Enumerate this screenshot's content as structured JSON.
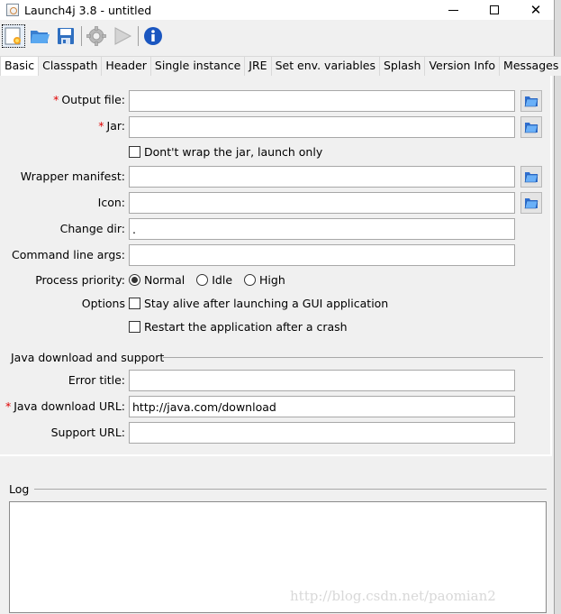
{
  "window": {
    "title": "Launch4j 3.8 - untitled",
    "controls": {
      "minimize": "minimize",
      "maximize": "maximize",
      "close": "✕"
    }
  },
  "toolbar": {
    "buttons": [
      {
        "name": "new-config",
        "icon": "new-file-icon",
        "selected": true
      },
      {
        "name": "open-config",
        "icon": "folder-open-icon"
      },
      {
        "name": "save-config",
        "icon": "save-icon"
      },
      {
        "name": "build-wrapper",
        "icon": "gear-icon",
        "disabled": true
      },
      {
        "name": "test-wrapper",
        "icon": "play-icon",
        "disabled": true
      },
      {
        "name": "about",
        "icon": "info-icon"
      }
    ]
  },
  "tabs": [
    {
      "label": "Basic",
      "active": true
    },
    {
      "label": "Classpath"
    },
    {
      "label": "Header"
    },
    {
      "label": "Single instance"
    },
    {
      "label": "JRE"
    },
    {
      "label": "Set env. variables"
    },
    {
      "label": "Splash"
    },
    {
      "label": "Version Info"
    },
    {
      "label": "Messages"
    }
  ],
  "basic": {
    "required_marker": "*",
    "output_file": {
      "label": "Output file:",
      "value": "",
      "required": true
    },
    "jar": {
      "label": "Jar:",
      "value": "",
      "required": true
    },
    "dont_wrap": {
      "label": "Dont't wrap the jar, launch only",
      "checked": false
    },
    "wrapper_manifest": {
      "label": "Wrapper manifest:",
      "value": ""
    },
    "icon": {
      "label": "Icon:",
      "value": ""
    },
    "change_dir": {
      "label": "Change dir:",
      "value": "."
    },
    "cmd_args": {
      "label": "Command line args:",
      "value": ""
    },
    "process_priority": {
      "label": "Process priority:",
      "options": [
        "Normal",
        "Idle",
        "High"
      ],
      "selected": "Normal"
    },
    "options": {
      "label": "Options",
      "stay_alive": {
        "label": "Stay alive after launching a GUI application",
        "checked": false
      },
      "restart": {
        "label": "Restart the application after a crash",
        "checked": false
      }
    },
    "java_group": {
      "title": "Java download and support",
      "error_title": {
        "label": "Error title:",
        "value": ""
      },
      "download_url": {
        "label": "Java download URL:",
        "value": "http://java.com/download",
        "required": true
      },
      "support_url": {
        "label": "Support URL:",
        "value": ""
      }
    }
  },
  "log": {
    "title": "Log",
    "content": ""
  },
  "watermark": "http://blog.csdn.net/paomian2"
}
